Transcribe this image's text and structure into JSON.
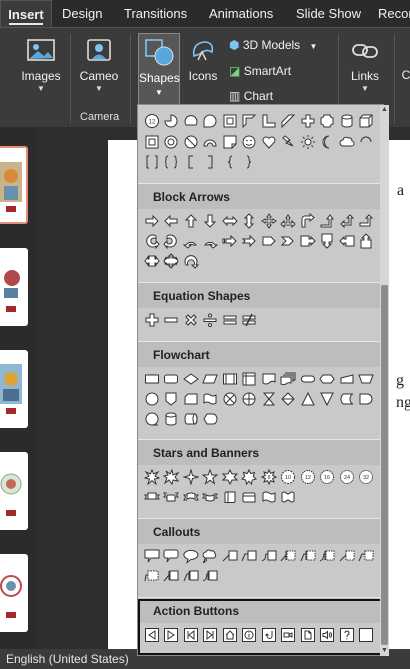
{
  "ribbon": {
    "tabs": [
      {
        "label": "Insert",
        "active": true
      },
      {
        "label": "Design"
      },
      {
        "label": "Transitions"
      },
      {
        "label": "Animations"
      },
      {
        "label": "Slide Show"
      },
      {
        "label": "Recor"
      }
    ],
    "images_label": "Images",
    "cameo_label": "Cameo",
    "camera_group": "Camera",
    "shapes_label": "Shapes",
    "icons_label": "Icons",
    "models_label": "3D Models",
    "smartart_label": "SmartArt",
    "chart_label": "Chart",
    "links_label": "Links",
    "cut_label": "C"
  },
  "canvas": {
    "fragments": [
      "a",
      "g",
      "ng"
    ]
  },
  "status": {
    "language": "English (United States)"
  },
  "shapes_menu": {
    "sections": [
      {
        "title": "Block Arrows"
      },
      {
        "title": "Equation Shapes"
      },
      {
        "title": "Flowchart"
      },
      {
        "title": "Stars and Banners"
      },
      {
        "title": "Callouts"
      },
      {
        "title": "Action Buttons"
      }
    ],
    "star_numbers": [
      "8",
      "10",
      "12",
      "16",
      "24",
      "32"
    ],
    "highlighted_section": "Action Buttons",
    "colors": {
      "panel": "#c9c9c9",
      "header": "#bdbdbd",
      "highlight": "#111111"
    }
  }
}
